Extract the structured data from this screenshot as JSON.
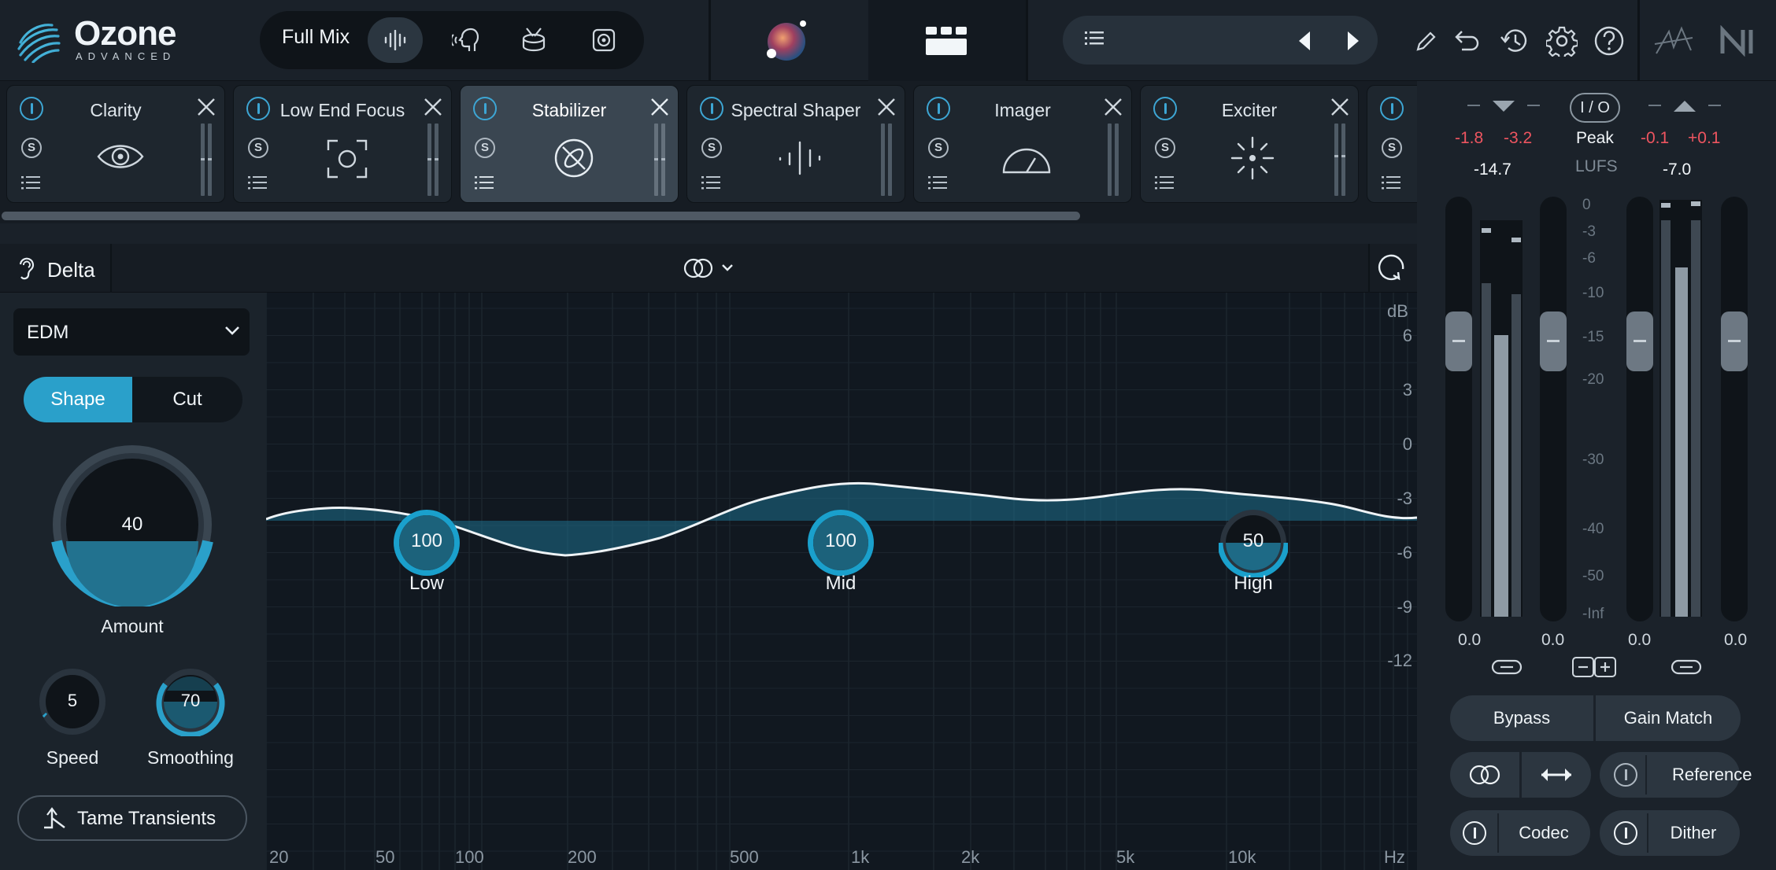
{
  "app": {
    "name": "Ozone",
    "edition": "ADVANCED"
  },
  "topbar": {
    "mix_mode": "Full Mix"
  },
  "modules": [
    {
      "name": "Clarity",
      "icon": "eye-icon"
    },
    {
      "name": "Low End Focus",
      "icon": "focus-frame-icon"
    },
    {
      "name": "Stabilizer",
      "icon": "stabilizer-icon",
      "selected": true
    },
    {
      "name": "Spectral Shaper",
      "icon": "spectral-lines-icon"
    },
    {
      "name": "Imager",
      "icon": "imager-arc-icon"
    },
    {
      "name": "Exciter",
      "icon": "exciter-burst-icon"
    }
  ],
  "midbar": {
    "delta_label": "Delta"
  },
  "left": {
    "preset": "EDM",
    "mode_shape": "Shape",
    "mode_cut": "Cut",
    "amount_value": "40",
    "amount_label": "Amount",
    "speed_value": "5",
    "speed_label": "Speed",
    "smoothing_value": "70",
    "smoothing_label": "Smoothing",
    "tame_label": "Tame Transients"
  },
  "graph": {
    "db_unit": "dB",
    "db_ticks": [
      "6",
      "3",
      "0",
      "-3",
      "-6",
      "-9",
      "-12"
    ],
    "freq_ticks": [
      "20",
      "50",
      "100",
      "200",
      "500",
      "1k",
      "2k",
      "5k",
      "10k"
    ],
    "freq_unit": "Hz",
    "bands": [
      {
        "value": "100",
        "label": "Low"
      },
      {
        "value": "100",
        "label": "Mid"
      },
      {
        "value": "50",
        "label": "High"
      }
    ]
  },
  "meters": {
    "io_label": "I / O",
    "in_peak_l": "-1.8",
    "in_peak_r": "-3.2",
    "peak_label": "Peak",
    "out_peak_l": "-0.1",
    "out_peak_r": "+0.1",
    "in_lufs": "-14.7",
    "lufs_label": "LUFS",
    "out_lufs": "-7.0",
    "scale": [
      "0",
      "-3",
      "-6",
      "-10",
      "-15",
      "-20",
      "-30",
      "-40",
      "-50",
      "-Inf"
    ],
    "gain_in_l": "0.0",
    "gain_in_r": "0.0",
    "gain_out_l": "0.0",
    "gain_out_r": "0.0"
  },
  "buttons": {
    "bypass": "Bypass",
    "gain_match": "Gain Match",
    "reference": "Reference",
    "codec": "Codec",
    "dither": "Dither"
  },
  "colors": {
    "accent": "#2aa0ca",
    "peak_red": "#ee5560",
    "background": "#161c23"
  }
}
